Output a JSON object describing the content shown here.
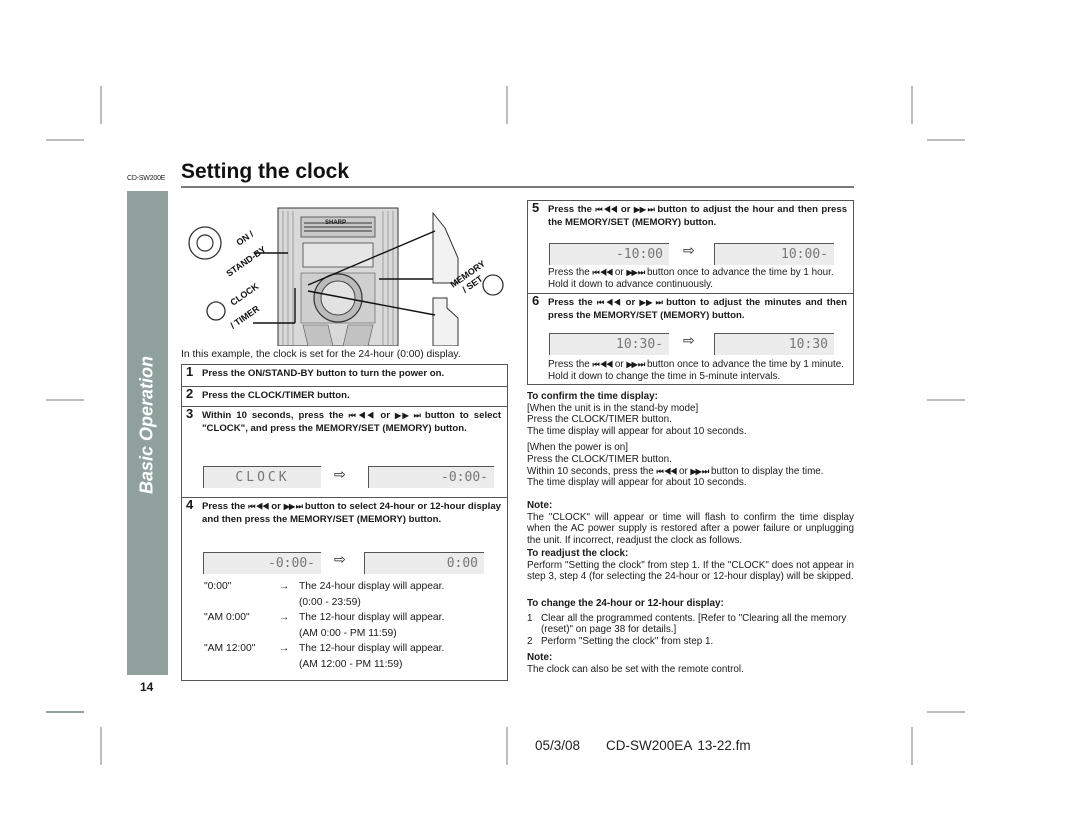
{
  "header": {
    "model_label": "CD-SW200E",
    "title": "Setting the clock"
  },
  "sidebar": {
    "section_label": "Basic Operation",
    "page_number": "14"
  },
  "illustration": {
    "brand": "SHARP",
    "labels": {
      "on_standby": "ON / STAND-BY",
      "clock_timer": "CLOCK / TIMER",
      "memory_set": "MEMORY / SET"
    },
    "caption": "In this example, the clock is set for the 24-hour (0:00) display."
  },
  "skip_buttons_glyph": {
    "back": "⏮ ◀◀",
    "or": "or",
    "forward": "▶▶ ⏭"
  },
  "steps_left": [
    {
      "num": "1",
      "text": "Press the ON/STAND-BY button to turn the power on."
    },
    {
      "num": "2",
      "text": "Press the CLOCK/TIMER button."
    },
    {
      "num": "3",
      "text_before": "Within 10 seconds, press the",
      "text_after": "button to select \"CLOCK\", and press the MEMORY/SET (MEMORY) button.",
      "display_from": "CLOCK",
      "display_to": "-0:00-"
    },
    {
      "num": "4",
      "text_before": "Press the",
      "text_after": "button to select 24-hour or 12-hour display and then press the MEMORY/SET (MEMORY) button.",
      "display_from": "-0:00-",
      "display_to": "0:00",
      "options": [
        {
          "key": "\"0:00\"",
          "arrow": "→",
          "desc": "The 24-hour display will appear.",
          "range": "(0:00 - 23:59)"
        },
        {
          "key": "\"AM 0:00\"",
          "arrow": "→",
          "desc": "The 12-hour display will appear.",
          "range": "(AM 0:00 - PM 11:59)"
        },
        {
          "key": "\"AM 12:00\"",
          "arrow": "→",
          "desc": "The 12-hour display will appear.",
          "range": "(AM 12:00 - PM 11:59)"
        }
      ]
    }
  ],
  "steps_right": [
    {
      "num": "5",
      "text_before": "Press the",
      "text_after": "button to adjust the hour and then press the MEMORY/SET (MEMORY) button.",
      "display_from": "-10:00",
      "display_to": "10:00-",
      "note_before": "Press the",
      "note_after": "button once to advance the time by 1 hour. Hold it down to advance continuously."
    },
    {
      "num": "6",
      "text_before": "Press the",
      "text_after": "button to adjust the minutes and then press the MEMORY/SET (MEMORY) button.",
      "display_from": "10:30-",
      "display_to": "10:30",
      "note_before": "Press the",
      "note_after": "button once to advance the time by 1 minute. Hold it down to change the time in 5-minute intervals."
    }
  ],
  "arrow_symbol": "⇨",
  "confirm": {
    "heading": "To confirm the time display:",
    "standby_mode": "[When the unit is in the stand-by mode]",
    "standby_line1": "Press the CLOCK/TIMER button.",
    "standby_line2": "The time display will appear for about 10 seconds.",
    "power_on": "[When the power is on]",
    "power_line1": "Press the CLOCK/TIMER button.",
    "power_line2_before": "Within 10 seconds, press the",
    "power_line2_after": "button to display the time.",
    "power_line3": "The time display will appear for about 10 seconds."
  },
  "note1": {
    "heading": "Note:",
    "text": "The \"CLOCK\" will appear or time will flash to confirm the time display when the AC power supply is restored after a power failure or unplugging the unit. If incorrect, readjust the clock as follows."
  },
  "readjust": {
    "heading": "To readjust the clock:",
    "text": "Perform \"Setting the clock\" from step 1. If the \"CLOCK\" does not appear in step 3, step 4 (for selecting the 24-hour or 12-hour display) will be skipped."
  },
  "change_display": {
    "heading": "To change the 24-hour or 12-hour display:",
    "items": [
      {
        "n": "1",
        "text": "Clear all the programmed contents. [Refer to \"Clearing all the memory (reset)\" on page 38 for details.]"
      },
      {
        "n": "2",
        "text": "Perform \"Setting the clock\" from step 1."
      }
    ]
  },
  "note2": {
    "heading": "Note:",
    "text": "The clock can also be set with the remote control."
  },
  "footer": {
    "date": "05/3/08",
    "file": "CD-SW200EA 13-22.fm"
  }
}
